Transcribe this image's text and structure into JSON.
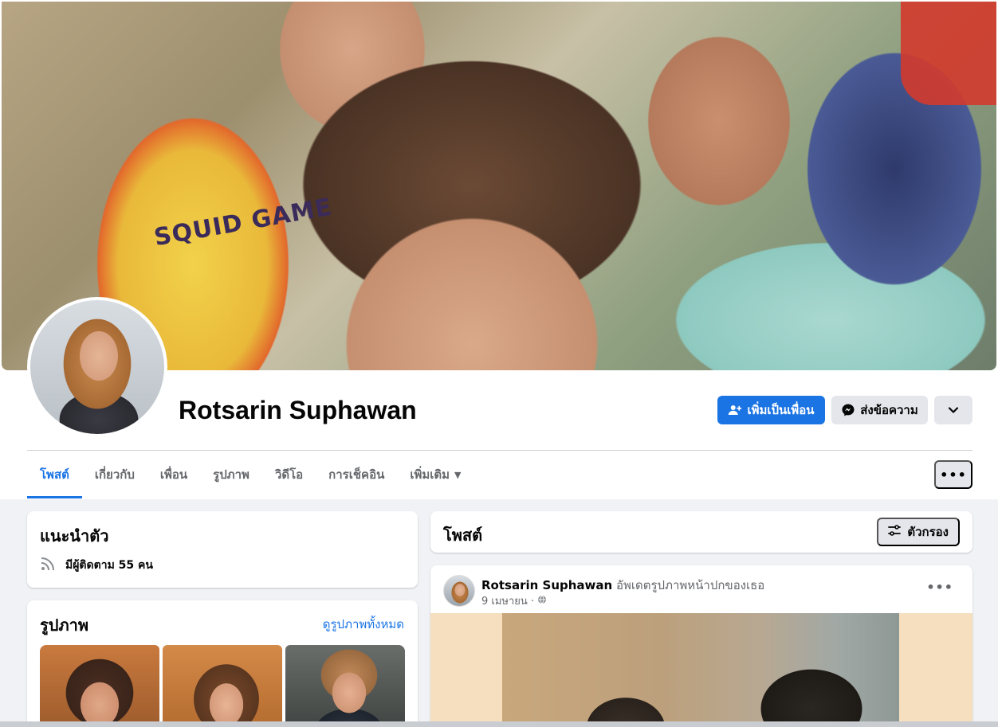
{
  "cover": {
    "shirt_text": "SQUID GAME"
  },
  "profile": {
    "name": "Rotsarin Suphawan",
    "add_friend_label": "เพิ่มเป็นเพื่อน",
    "message_label": "ส่งข้อความ"
  },
  "tabs": [
    {
      "label": "โพสต์",
      "active": true
    },
    {
      "label": "เกี่ยวกับ"
    },
    {
      "label": "เพื่อน"
    },
    {
      "label": "รูปภาพ"
    },
    {
      "label": "วิดีโอ"
    },
    {
      "label": "การเช็คอิน"
    },
    {
      "label": "เพิ่มเติม"
    }
  ],
  "intro": {
    "title": "แนะนำตัว",
    "followers_text": "มีผู้ติดตาม 55 คน"
  },
  "photos": {
    "title": "รูปภาพ",
    "see_all": "ดูรูปภาพทั้งหมด"
  },
  "posts": {
    "title": "โพสต์",
    "filter_label": "ตัวกรอง"
  },
  "post": {
    "author": "Rotsarin Suphawan",
    "action": "อัพเดตรูปภาพหน้าปกของเธอ",
    "date": "9 เมษายน ·"
  },
  "colors": {
    "accent": "#1b74e4",
    "background": "#f0f2f5",
    "secondary_button": "#e4e6eb",
    "muted_text": "#65676b"
  },
  "icons": {
    "add_friend": "person-plus-icon",
    "message": "messenger-icon",
    "caret": "chevron-down-icon",
    "more": "more-dots-icon",
    "follow": "rss-icon",
    "filter": "sliders-icon",
    "privacy": "globe-icon"
  }
}
